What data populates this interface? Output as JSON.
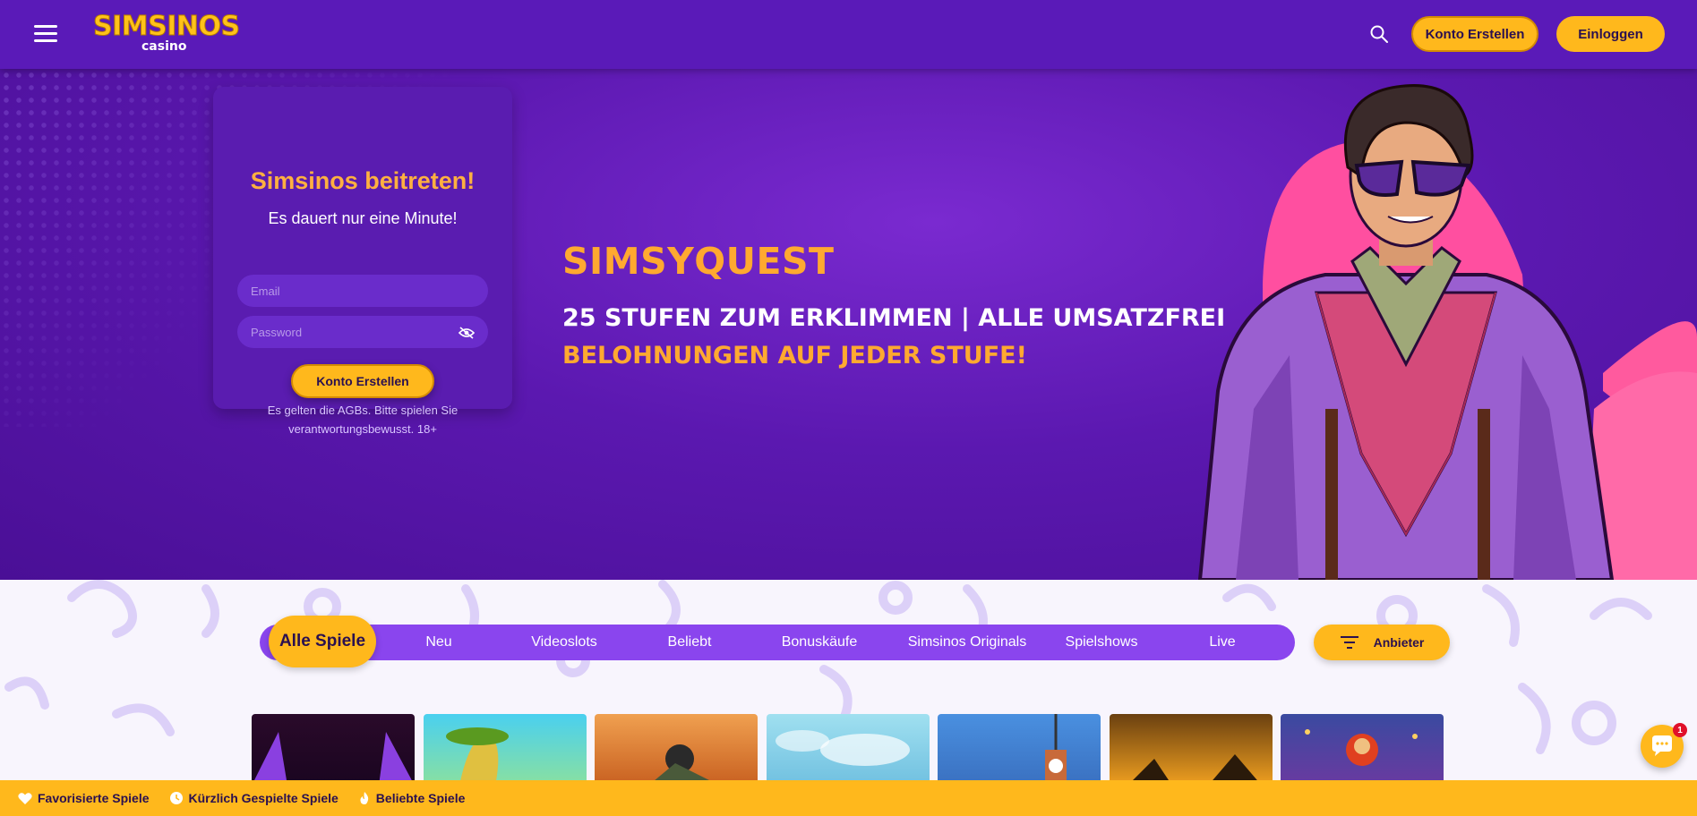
{
  "header": {
    "logo_main": "SIMSINOS",
    "logo_sub": "casino",
    "register_label": "Konto Erstellen",
    "login_label": "Einloggen"
  },
  "signup": {
    "title": "Simsinos beitreten!",
    "subtitle": "Es dauert nur eine Minute!",
    "email_placeholder": "Email",
    "password_placeholder": "Password",
    "submit_label": "Konto Erstellen",
    "terms": "Es gelten die AGBs. Bitte spielen Sie verantwortungsbewusst. 18+"
  },
  "promo": {
    "title": "SIMSYQUEST",
    "line2": "25 STUFEN ZUM ERKLIMMEN | ALLE UMSATZFREI",
    "line3": "BELOHNUNGEN AUF JEDER STUFE!"
  },
  "categories": {
    "items": [
      {
        "label": "Alle Spiele"
      },
      {
        "label": "Neu"
      },
      {
        "label": "Videoslots"
      },
      {
        "label": "Beliebt"
      },
      {
        "label": "Bonuskäufe"
      },
      {
        "label": "Simsinos Originals"
      },
      {
        "label": "Spielshows"
      },
      {
        "label": "Live"
      }
    ],
    "provider_label": "Anbieter"
  },
  "chat": {
    "badge": "1"
  },
  "bottom_bar": {
    "items": [
      {
        "label": "Favorisierte Spiele",
        "icon": "heart-icon"
      },
      {
        "label": "Kürzlich Gespielte Spiele",
        "icon": "clock-icon"
      },
      {
        "label": "Beliebte Spiele",
        "icon": "flame-icon"
      }
    ]
  },
  "colors": {
    "header_bg": "#5a1ab8",
    "accent_yellow": "#ffb81c",
    "accent_orange": "#ffa930",
    "category_bar": "#8a45ee"
  }
}
